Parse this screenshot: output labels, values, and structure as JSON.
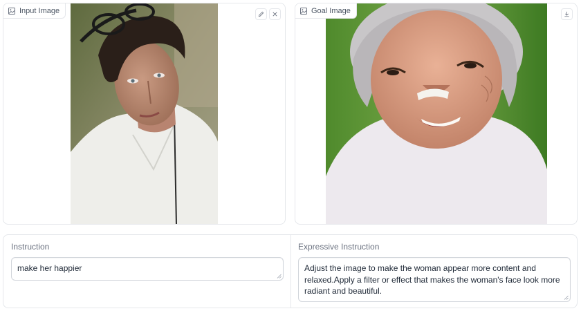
{
  "input_panel": {
    "label": "Input Image",
    "image_alt": "Photo of a woman with short dark hair, sunglasses on her head, in a white shirt"
  },
  "goal_panel": {
    "label": "Goal Image",
    "image_alt": "Photo of an elderly gray-haired woman smiling broadly, in a white top"
  },
  "instruction": {
    "label": "Instruction",
    "value": "make her happier"
  },
  "expressive_instruction": {
    "label": "Expressive Instruction",
    "value": "Adjust the image to make the woman appear more content and relaxed.Apply a filter or effect that makes the woman's face look more radiant and beautiful."
  },
  "icons": {
    "image_label": "image-icon",
    "edit": "pencil-icon",
    "clear": "close-icon",
    "download": "download-icon"
  }
}
